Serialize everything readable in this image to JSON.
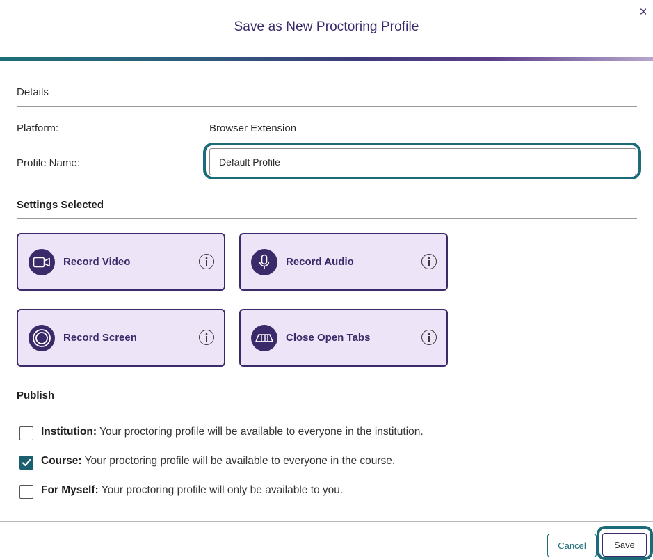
{
  "dialog": {
    "title": "Save as New Proctoring Profile",
    "close_label": "×"
  },
  "details": {
    "heading": "Details",
    "platform_label": "Platform:",
    "platform_value": "Browser Extension",
    "profile_name_label": "Profile Name:",
    "profile_name_value": "Default Profile"
  },
  "settings": {
    "heading": "Settings Selected",
    "items": [
      {
        "label": "Record Video",
        "icon": "video-camera-icon"
      },
      {
        "label": "Record Audio",
        "icon": "microphone-icon"
      },
      {
        "label": "Record Screen",
        "icon": "screen-record-icon"
      },
      {
        "label": "Close Open Tabs",
        "icon": "tabs-icon"
      }
    ]
  },
  "publish": {
    "heading": "Publish",
    "options": [
      {
        "title": "Institution:",
        "text": " Your proctoring profile will be available to everyone in the institution.",
        "checked": false
      },
      {
        "title": "Course:",
        "text": " Your proctoring profile will be available to everyone in the course.",
        "checked": true
      },
      {
        "title": "For Myself:",
        "text": " Your proctoring profile will only be available to you.",
        "checked": false
      }
    ]
  },
  "footer": {
    "cancel_label": "Cancel",
    "save_label": "Save"
  },
  "colors": {
    "primary_purple": "#3b2a6a",
    "card_background": "#ede4f7",
    "accent_teal": "#1b6b78"
  }
}
